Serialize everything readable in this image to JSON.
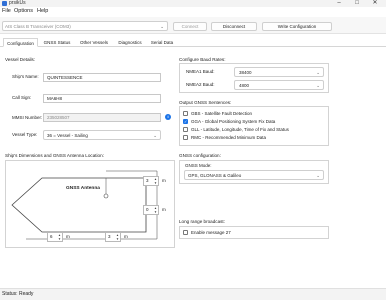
{
  "window": {
    "title": "prsikUs"
  },
  "menu": {
    "items": [
      "File",
      "Options",
      "Help"
    ]
  },
  "toolbar": {
    "device_combo": "AIS Class B Transceiver (COM3)",
    "connect_label": "Connect",
    "disconnect_label": "Disconnect",
    "write_label": "Write Configuration"
  },
  "tabs": [
    "Configuration",
    "GNSS Status",
    "Other Vessels",
    "Diagnostics",
    "Serial Data"
  ],
  "vessel": {
    "section_title": "Vessel Details:",
    "ships_name_label": "Ship's Name:",
    "ships_name_value": "QUINTESSENCE",
    "call_sign_label": "Call Sign:",
    "call_sign_value": "MA6H8",
    "mmsi_label": "MMSI Number:",
    "mmsi_value": "235028507",
    "vessel_type_label": "Vessel Type:",
    "vessel_type_value": "36 = Vessel - Sailing"
  },
  "dimensions": {
    "section_title": "Ship's Dimensions and GNSS Antenna Location:",
    "antenna_label": "GNSS Antenna",
    "a_value": "3",
    "b_value": "0",
    "c_value": "6",
    "d_value": "3",
    "unit": "m"
  },
  "baud": {
    "section_title": "Configure Baud Rates:",
    "nmea1_label": "NMEA1 Baud:",
    "nmea1_value": "38400",
    "nmea2_label": "NMEA2 Baud:",
    "nmea2_value": "4800"
  },
  "sentences": {
    "section_title": "Output GNSS Sentences:",
    "items": [
      {
        "label": "GBS - Satellite Fault Detection",
        "checked": false
      },
      {
        "label": "GGA - Global Positioning System Fix Data",
        "checked": true
      },
      {
        "label": "GLL - Latitude, Longitude, Time of Fix and Status",
        "checked": false
      },
      {
        "label": "RMC - Recommended Minimum Data",
        "checked": false
      }
    ]
  },
  "gnss": {
    "section_title": "GNSS configuration:",
    "mode_label": "GNSS Mode:",
    "mode_value": "GPS, GLONASS & Galileo"
  },
  "broadcast": {
    "section_title": "Long range broadcast:",
    "enable_label": "Enable message 27"
  },
  "status": {
    "text": "Status: Ready"
  },
  "colors": {
    "accent": "#1a73e8",
    "checked": "#1a73e8"
  }
}
